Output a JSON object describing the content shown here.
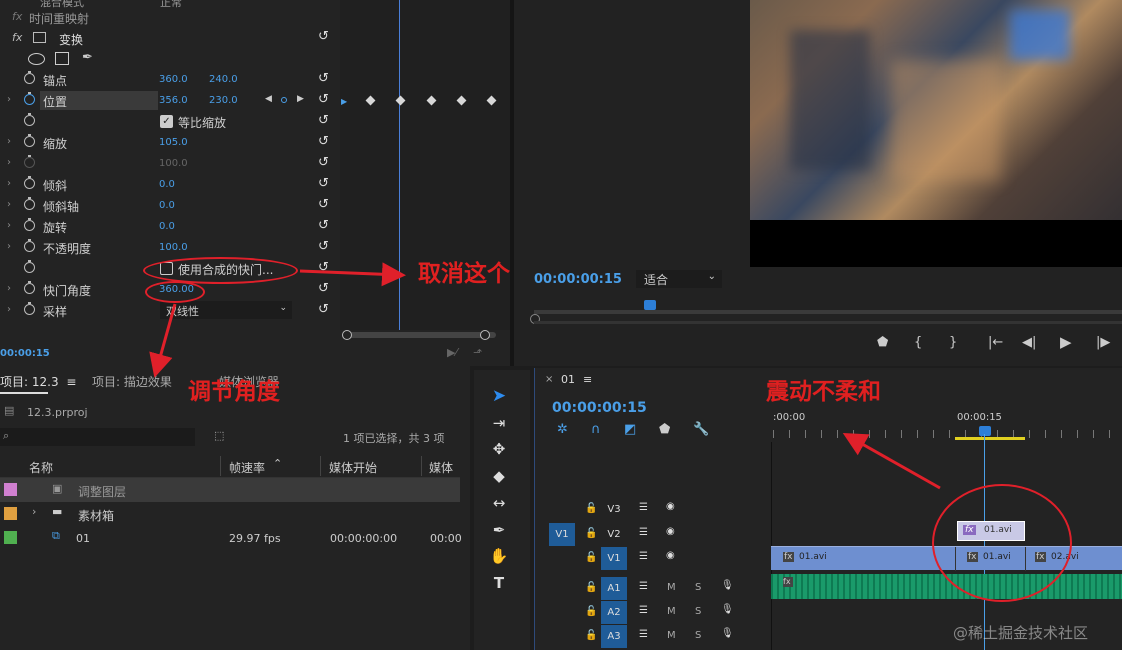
{
  "effect_controls": {
    "partial_top": "混合模式",
    "partial_top_val": "正常",
    "time_remap": "时间重映射",
    "transform": "变换",
    "anchor": {
      "label": "锚点",
      "x": "360.0",
      "y": "240.0"
    },
    "position": {
      "label": "位置",
      "x": "356.0",
      "y": "230.0"
    },
    "uniform_scale": "等比缩放",
    "scale": {
      "label": "缩放",
      "value": "105.0"
    },
    "scale_width": "100.0",
    "skew": {
      "label": "倾斜",
      "value": "0.0"
    },
    "skew_axis": {
      "label": "倾斜轴",
      "value": "0.0"
    },
    "rotation": {
      "label": "旋转",
      "value": "0.0"
    },
    "opacity": {
      "label": "不透明度",
      "value": "100.0"
    },
    "use_comp_shutter": "使用合成的快门...",
    "shutter_angle": {
      "label": "快门角度",
      "value": "360.00"
    },
    "sampling": {
      "label": "采样",
      "value": "双线性"
    },
    "timecode": "00:00:15"
  },
  "program": {
    "timecode": "00:00:00:15",
    "fit": "适合"
  },
  "project": {
    "tab_project": "项目: 12.3",
    "tab_project2": "项目: 描边效果",
    "tab_media": "媒体浏览器",
    "file": "12.3.prproj",
    "selection": "1 项已选择，共 3 项",
    "col_name": "名称",
    "col_fps": "帧速率",
    "col_start": "媒体开始",
    "col_media": "媒体",
    "items": [
      {
        "name": "调整图层",
        "color": "#d080d0",
        "fps": "",
        "start": "",
        "end": ""
      },
      {
        "name": "素材箱",
        "color": "#e0a040",
        "fps": "",
        "start": "",
        "end": ""
      },
      {
        "name": "01",
        "color": "#50b050",
        "fps": "29.97 fps",
        "start": "00:00:00:00",
        "end": "00:00"
      }
    ]
  },
  "timeline": {
    "tab": "01",
    "timecode": "00:00:00:15",
    "ruler_start": ":00:00",
    "ruler_mark": "00:00:15",
    "tracks": [
      {
        "id": "V3"
      },
      {
        "id": "V2"
      },
      {
        "id": "V1"
      },
      {
        "id": "A1"
      },
      {
        "id": "A2"
      },
      {
        "id": "A3"
      }
    ],
    "src_v1": "V1",
    "clip_v2": "01.avi",
    "clip_v1a": "01.avi",
    "clip_v1b": "01.avi",
    "clip_v1c": "02.avi",
    "track_m": "M",
    "track_s": "S"
  },
  "annotations": {
    "cancel": "取消这个",
    "adjust": "调节角度",
    "shake": "震动不柔和"
  },
  "watermark": "@稀土掘金技术社区"
}
